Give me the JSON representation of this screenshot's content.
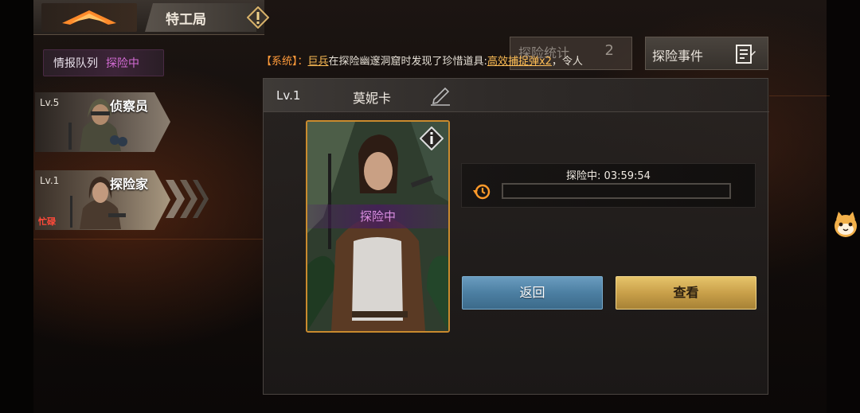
{
  "header": {
    "title": "特工局",
    "back_icon": "back-arrow-icon",
    "warning_icon": "warning-icon"
  },
  "team": {
    "label": "情报队列",
    "status": "探险中"
  },
  "agents": [
    {
      "level": "Lv.5",
      "role": "侦察员",
      "busy": "",
      "selected": false
    },
    {
      "level": "Lv.1",
      "role": "探险家",
      "busy": "忙碌",
      "selected": true
    }
  ],
  "system_message": {
    "tag": "【系统】",
    "sep": "：",
    "player": "巨兵",
    "text": "在探险幽邃洞窟时发现了珍惜道具:",
    "item": "高效捕捉弹x2",
    "tail": "，令人"
  },
  "stats_button": {
    "label": "探险统计",
    "count": "2"
  },
  "events_button": {
    "label": "探险事件",
    "icon": "notepad-icon"
  },
  "panel": {
    "level": "Lv.1",
    "name": "莫妮卡",
    "status_band": "探险中",
    "progress_text": "探险中: 03:59:54",
    "progress": 0.0,
    "back_button": "返回",
    "view_button": "查看"
  },
  "colors": {
    "accent_orange": "#ff9a3a",
    "purple_status": "#d36bd4",
    "card_border": "#c98a2e",
    "back_blue": "#4c7fa2",
    "view_gold": "#c9a04a"
  }
}
